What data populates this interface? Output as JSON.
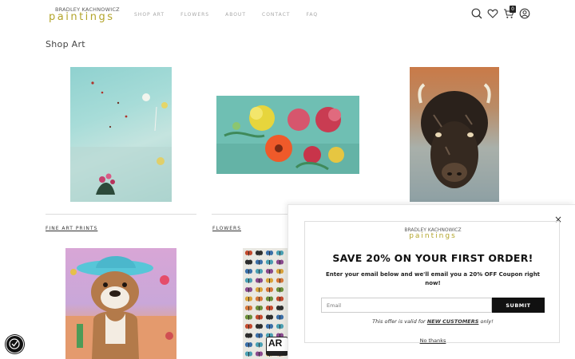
{
  "header": {
    "logo_top": "BRADLEY KACHNOWICZ",
    "logo_main": "paintings",
    "nav": [
      "SHOP ART",
      "FLOWERS",
      "ABOUT",
      "CONTACT",
      "FAQ"
    ],
    "cart_count": "0",
    "icons": [
      "search-icon",
      "wishlist-heart-icon",
      "cart-icon",
      "account-icon"
    ]
  },
  "page_title": "Shop Art",
  "categories": [
    {
      "label": "FINE ART PRINTS"
    },
    {
      "label": "FLOWERS"
    }
  ],
  "popup": {
    "logo_top": "BRADLEY KACHNOWICZ",
    "logo_main": "paintings",
    "heading": "SAVE 20% ON YOUR FIRST ORDER!",
    "subtext": "Enter your email below and we'll email you a 20% OFF Coupon right now!",
    "email_placeholder": "Email",
    "submit_label": "SUBMIT",
    "offer_prefix": "This offer is valid for",
    "offer_highlight": "NEW CUSTOMERS",
    "offer_suffix": "only!",
    "no_thanks": "No thanks",
    "close_symbol": "×"
  },
  "badge_text": "AR",
  "colors": {
    "brand_gold": "#b3a52b",
    "nav_gray": "#a8a8a8",
    "submit_bg": "#111111"
  }
}
